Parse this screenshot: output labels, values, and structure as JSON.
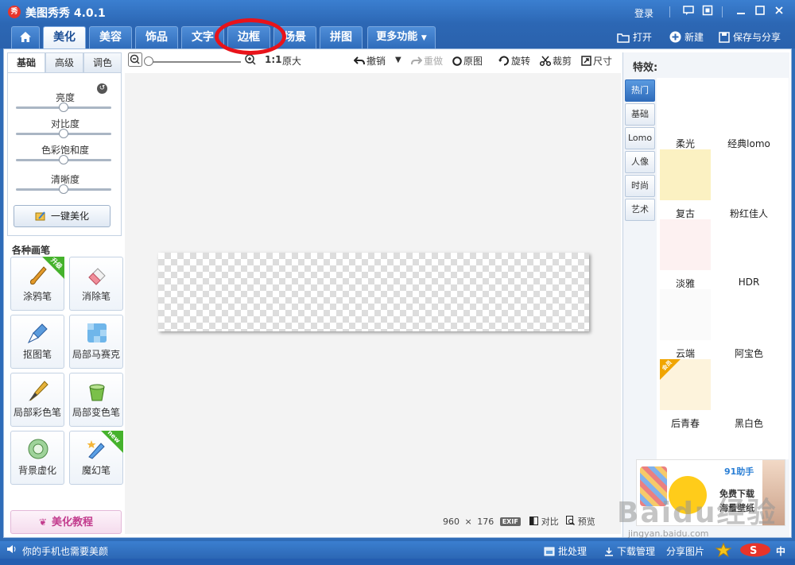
{
  "window": {
    "title": "美图秀秀 4.0.1",
    "logo": "秀",
    "login": "登录"
  },
  "nav": {
    "tabs": [
      "美化",
      "美容",
      "饰品",
      "文字",
      "边框",
      "场景",
      "拼图"
    ],
    "more": "更多功能",
    "actions": {
      "open": "打开",
      "new": "新建",
      "save_share": "保存与分享"
    }
  },
  "left": {
    "subtabs": [
      "基础",
      "高级",
      "调色"
    ],
    "sliders": [
      {
        "label": "亮度",
        "value": 0.5
      },
      {
        "label": "对比度",
        "value": 0.5
      },
      {
        "label": "色彩饱和度",
        "value": 0.5
      },
      {
        "label": "清晰度",
        "value": 0.5
      }
    ],
    "one_click": "一键美化",
    "brushes_title": "各种画笔",
    "brushes": [
      {
        "label": "涂鸦笔",
        "badge": "升级"
      },
      {
        "label": "消除笔"
      },
      {
        "label": "抠图笔"
      },
      {
        "label": "局部马赛克"
      },
      {
        "label": "局部彩色笔"
      },
      {
        "label": "局部变色笔"
      },
      {
        "label": "背景虚化"
      },
      {
        "label": "魔幻笔",
        "badge": "new"
      }
    ],
    "tutorial": "美化教程"
  },
  "toolbar": {
    "ratio": "1:1",
    "original_size": "原大",
    "undo": "撤销",
    "redo": "重做",
    "original": "原图",
    "rotate": "旋转",
    "crop": "裁剪",
    "size": "尺寸"
  },
  "canvas": {
    "width_px": "960",
    "times": "×",
    "height_px": "176",
    "exif": "EXIF",
    "compare": "对比",
    "preview": "预览"
  },
  "effects": {
    "title": "特效:",
    "categories": [
      "热门",
      "基础",
      "Lomo",
      "人像",
      "时尚",
      "艺术"
    ],
    "items": [
      {
        "label": "柔光",
        "color": "#ffffff"
      },
      {
        "label": "经典lomo",
        "color": "#ffffff"
      },
      {
        "label": "复古",
        "color": "#fbf1c2"
      },
      {
        "label": "粉红佳人",
        "color": "#ffffff"
      },
      {
        "label": "淡雅",
        "color": "#fdf1f1"
      },
      {
        "label": "HDR",
        "color": "#ffffff"
      },
      {
        "label": "云端",
        "color": "#fafafa"
      },
      {
        "label": "阿宝色",
        "color": "#ffffff"
      },
      {
        "label": "后青春",
        "color": "#fdf3dc",
        "badge": "会员"
      },
      {
        "label": "黑白色",
        "color": "#ffffff"
      }
    ],
    "ad": {
      "brand": "91助手",
      "line1": "免费下载",
      "line2": "海量壁纸"
    }
  },
  "status": {
    "message": "你的手机也需要美颜",
    "batch": "批处理",
    "download": "下载管理",
    "share": "分享图片",
    "ime": "中"
  },
  "watermark": {
    "brand": "Baidu经验",
    "url": "jingyan.baidu.com"
  },
  "colors": {
    "accent": "#2f6cb8",
    "annotation": "#e8131a"
  }
}
